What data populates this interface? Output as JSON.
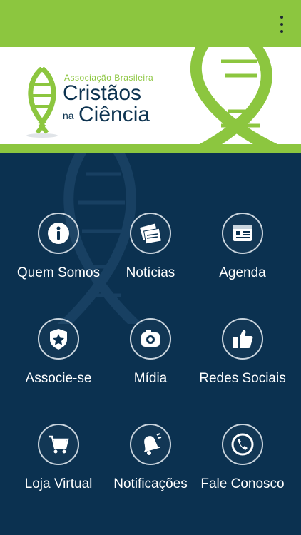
{
  "topbar": {
    "menu_icon": "more-vertical-icon",
    "color": "#8cc63f"
  },
  "logo": {
    "line1": "Associação Brasileira",
    "line2": "Cristãos",
    "line3a": "na",
    "line3b": "Ciência"
  },
  "tiles": [
    {
      "label": "Quem Somos",
      "icon": "info-icon"
    },
    {
      "label": "Notícias",
      "icon": "newspaper-icon"
    },
    {
      "label": "Agenda",
      "icon": "calendar-icon"
    },
    {
      "label": "Associe-se",
      "icon": "badge-star-icon"
    },
    {
      "label": "Mídia",
      "icon": "camera-icon"
    },
    {
      "label": "Redes Sociais",
      "icon": "thumbs-up-icon"
    },
    {
      "label": "Loja Virtual",
      "icon": "shopping-cart-icon"
    },
    {
      "label": "Notificações",
      "icon": "bell-icon"
    },
    {
      "label": "Fale Conosco",
      "icon": "phone-icon"
    }
  ],
  "colors": {
    "background": "#0b3150",
    "accent": "#8cc63f",
    "text": "#ffffff"
  }
}
